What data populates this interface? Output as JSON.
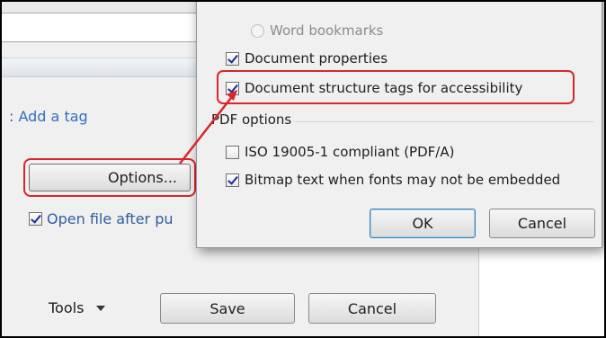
{
  "background_dialog": {
    "tags_prefix": ":",
    "tags_link": "Add a tag",
    "options_button": "Options...",
    "open_file_label": "Open file after pu",
    "open_file_checked": true,
    "tools_label": "Tools",
    "save_button": "Save",
    "cancel_button": "Cancel"
  },
  "options_dialog": {
    "word_bookmarks_label": "Word bookmarks",
    "document_properties_label": "Document properties",
    "document_properties_checked": true,
    "structure_tags_label": "Document structure tags for accessibility",
    "structure_tags_checked": true,
    "pdf_options_group_label": "PDF options",
    "iso_label": "ISO 19005-1 compliant (PDF/A)",
    "iso_checked": false,
    "bitmap_label": "Bitmap text when fonts may not be embedded",
    "bitmap_checked": true,
    "ok_button": "OK",
    "cancel_button": "Cancel"
  },
  "colors": {
    "callout_red": "#d8262a",
    "link_blue": "#2f6fc0",
    "check_blue": "#1f2a9b"
  }
}
